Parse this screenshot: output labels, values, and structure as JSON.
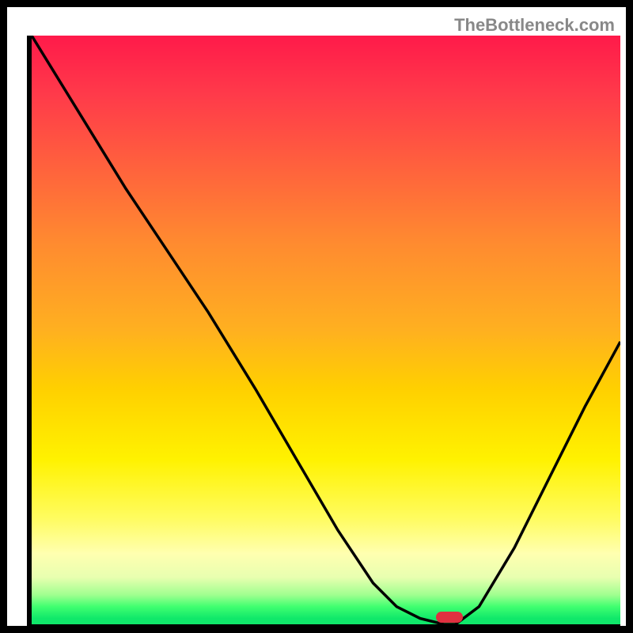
{
  "watermark": "TheBottleneck.com",
  "chart_data": {
    "type": "line",
    "title": "",
    "xlabel": "",
    "ylabel": "",
    "x": [
      0.0,
      0.08,
      0.16,
      0.24,
      0.3,
      0.38,
      0.45,
      0.52,
      0.58,
      0.62,
      0.66,
      0.7,
      0.72,
      0.76,
      0.82,
      0.88,
      0.94,
      1.0
    ],
    "y": [
      1.0,
      0.87,
      0.74,
      0.62,
      0.53,
      0.4,
      0.28,
      0.16,
      0.07,
      0.03,
      0.01,
      0.0,
      0.0,
      0.03,
      0.13,
      0.25,
      0.37,
      0.48
    ],
    "xlim": [
      0,
      1
    ],
    "ylim": [
      0,
      1
    ],
    "marker": {
      "x": 0.71,
      "y": 0.0,
      "color": "#e03040"
    },
    "gradient_stops": [
      {
        "pos": 0.0,
        "color": "#ff1a4a"
      },
      {
        "pos": 0.5,
        "color": "#ffd000"
      },
      {
        "pos": 0.85,
        "color": "#ffff80"
      },
      {
        "pos": 1.0,
        "color": "#10e86a"
      }
    ]
  }
}
